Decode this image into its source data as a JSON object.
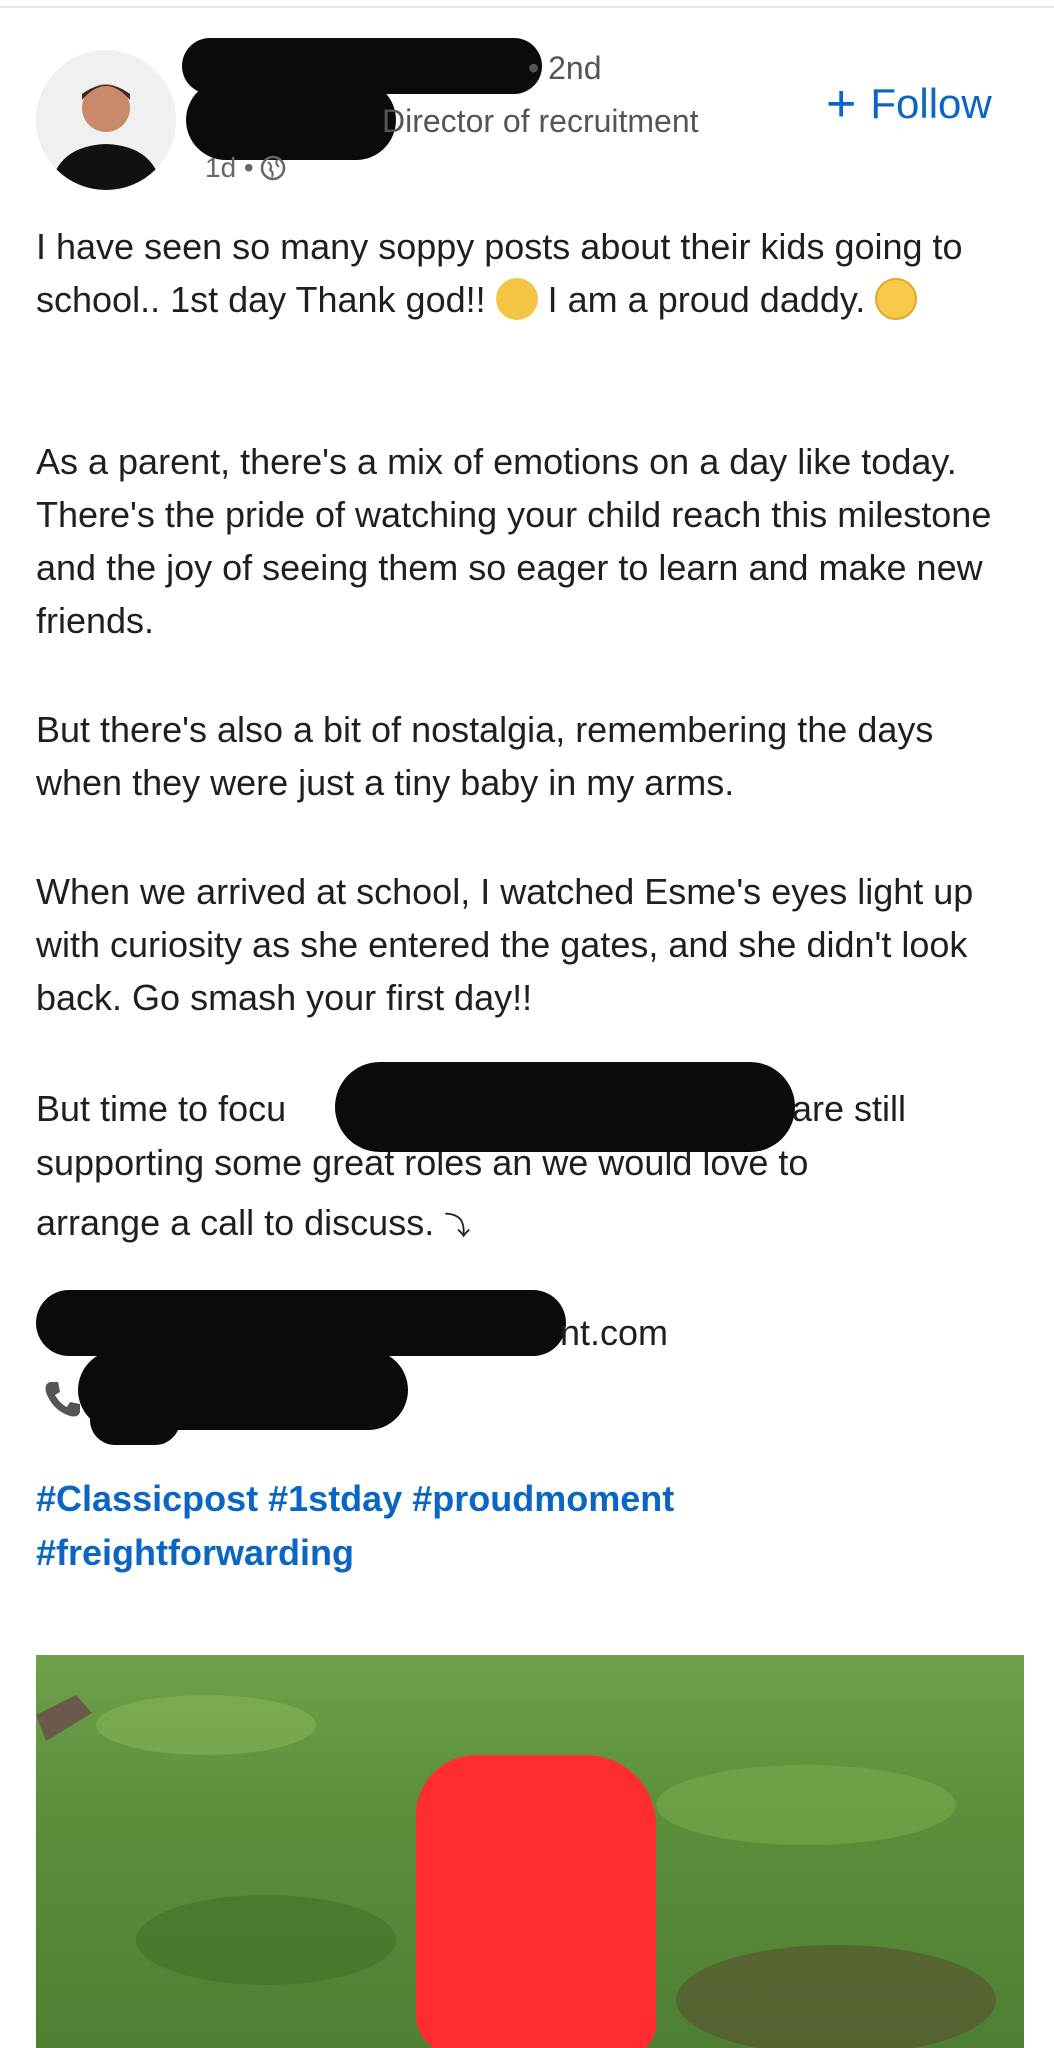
{
  "post": {
    "author": {
      "degree": "• 2nd",
      "headline": "Director of recruitment",
      "time": "1d •"
    },
    "follow_label": "Follow",
    "paragraphs": [
      "I have seen so many soppy posts about their kids going to school.. 1st day Thank god!!",
      "I am a proud",
      "daddy.",
      "As a parent, there's a mix of emotions on a day like today. There's the pride of watching your child reach this milestone and the joy of seeing them so eager to learn and make new friends.",
      "But there's also a bit of nostalgia, remembering the days when they were just a tiny baby in my arms.",
      "When we arrived at school, I watched Esme's eyes light up with curiosity as she entered the gates, and she didn't look back. Go smash your first day!!"
    ],
    "cta": {
      "start": "But time to focu",
      "end": "are still",
      "line2": "supporting some great roles an we would love to",
      "line3": "arrange a call to discuss.",
      "arrow": "⤵"
    },
    "contact_suffix": "nt.com",
    "hashtags": [
      "#Classicpost",
      "#1stday",
      "#proudmoment",
      "#freightforwarding"
    ]
  },
  "colors": {
    "link": "#0a66c2",
    "redaction": "#0b0b0b",
    "redaction_red": "#ff2d2d"
  },
  "icons": [
    "globe-icon",
    "plus-icon",
    "waving-hand-emoji",
    "crying-face-emoji",
    "phone-icon",
    "curved-arrow-icon"
  ]
}
